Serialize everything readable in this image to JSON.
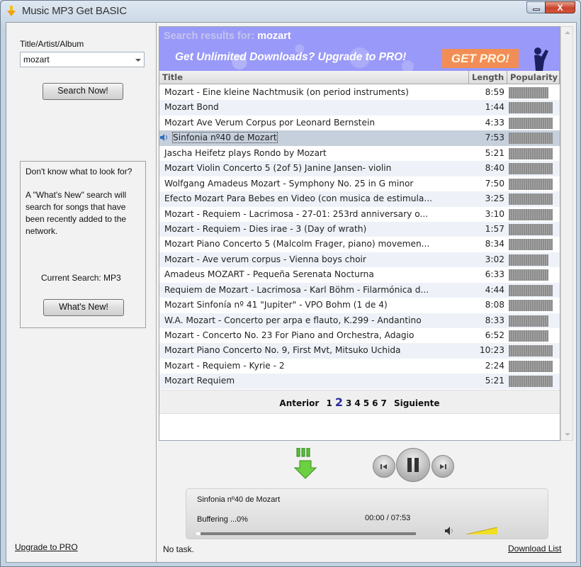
{
  "window": {
    "title": "Music MP3 Get BASIC",
    "minimize_label": "",
    "close_label": "X"
  },
  "sidebar": {
    "field_label": "Title/Artist/Album",
    "search_value": "mozart",
    "search_button": "Search Now!",
    "info": {
      "heading": "Don't know what to look for?",
      "body": "A \"What's New\" search will search for songs that have been recently added to the network.",
      "current_search": "Current Search: MP3",
      "whats_new_button": "What's New!"
    },
    "upgrade_link": "Upgrade to PRO"
  },
  "results": {
    "search_label": "Search results for:",
    "search_term": "mozart",
    "promo_text": "Get Unlimited Downloads? Upgrade to PRO!",
    "get_pro_button": "GET PRO!",
    "columns": [
      "Title",
      "Length",
      "Popularity"
    ],
    "rows": [
      {
        "title": "Mozart - Eine kleine Nachtmusik (on period instruments)",
        "length": "8:59",
        "popularity": 0.9
      },
      {
        "title": "Mozart Bond",
        "length": "1:44",
        "popularity": 1.0
      },
      {
        "title": "Mozart Ave Verum Corpus por Leonard Bernstein",
        "length": "4:33",
        "popularity": 1.0
      },
      {
        "title": "Sinfonia nº40 de Mozart",
        "length": "7:53",
        "popularity": 1.0,
        "playing": true
      },
      {
        "title": "Jascha Heifetz plays Rondo by Mozart",
        "length": "5:21",
        "popularity": 1.0
      },
      {
        "title": "Mozart Violin Concerto 5 (2of 5) Janine Jansen- violin",
        "length": "8:40",
        "popularity": 1.0
      },
      {
        "title": "Wolfgang Amadeus Mozart - Symphony No. 25 in G minor",
        "length": "7:50",
        "popularity": 1.0
      },
      {
        "title": "Efecto Mozart Para Bebes en Video (con musica de estimula...",
        "length": "3:25",
        "popularity": 1.0
      },
      {
        "title": "Mozart - Requiem - Lacrimosa - 27-01: 253rd anniversary o...",
        "length": "3:10",
        "popularity": 1.0
      },
      {
        "title": "Mozart - Requiem - Dies irae - 3 (Day of wrath)",
        "length": "1:57",
        "popularity": 1.0
      },
      {
        "title": "Mozart Piano Concerto 5 (Malcolm Frager, piano) movemen...",
        "length": "8:34",
        "popularity": 1.0
      },
      {
        "title": "Mozart - Ave verum corpus - Vienna boys choir",
        "length": "3:02",
        "popularity": 0.9
      },
      {
        "title": "Amadeus MOZART - Pequeña Serenata Nocturna",
        "length": "6:33",
        "popularity": 0.9
      },
      {
        "title": "Requiem de Mozart - Lacrimosa - Karl Böhm - Filarmónica d...",
        "length": "4:44",
        "popularity": 1.0
      },
      {
        "title": "Mozart Sinfonía nº 41 \"Jupiter\" - VPO Bohm (1 de 4)",
        "length": "8:08",
        "popularity": 1.0
      },
      {
        "title": "W.A. Mozart - Concerto per arpa e flauto, K.299 - Andantino",
        "length": "8:33",
        "popularity": 0.9
      },
      {
        "title": "Mozart - Concerto No. 23 For Piano and Orchestra, Adagio",
        "length": "6:52",
        "popularity": 0.9
      },
      {
        "title": "Mozart Piano Concerto No. 9, First Mvt, Mitsuko Uchida",
        "length": "10:23",
        "popularity": 1.0
      },
      {
        "title": "Mozart - Requiem - Kyrie - 2",
        "length": "2:24",
        "popularity": 1.0
      },
      {
        "title": "Mozart Requiem",
        "length": "5:21",
        "popularity": 1.0
      }
    ],
    "pager": {
      "prev": "Anterior",
      "pages": [
        "1",
        "2",
        "3",
        "4",
        "5",
        "6",
        "7"
      ],
      "current": "2",
      "next": "Siguiente"
    }
  },
  "player": {
    "track": "Sinfonia nº40 de Mozart",
    "buffering": "Buffering ...0%",
    "time": "00:00 / 07:53",
    "progress": 0.0
  },
  "statusbar": {
    "task": "No task.",
    "download_list_link": "Download List"
  },
  "colors": {
    "banner": "#9999f9",
    "get_pro": "#f28e55",
    "selected_row": "#c6cfdc"
  }
}
